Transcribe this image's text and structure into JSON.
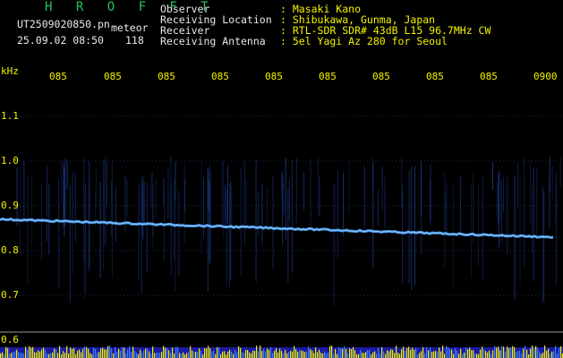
{
  "app": {
    "title": "H R O F F T"
  },
  "file": {
    "name": "UT2509020850.pn",
    "meteor_label": "meteor"
  },
  "timestamp": {
    "datetime": "25.09.02 08:50",
    "count": "118"
  },
  "info": {
    "rows": [
      {
        "label": "Observer",
        "value": ": Masaki Kano"
      },
      {
        "label": "Receiving Location",
        "value": ": Shibukawa, Gunma, Japan"
      },
      {
        "label": "Receiver",
        "value": ": RTL-SDR SDR# 43dB L15 96.7MHz CW"
      },
      {
        "label": "Receiving Antenna",
        "value": ": 5el Yagi Az 280 for Seoul"
      }
    ]
  },
  "axis": {
    "unit": "kHz",
    "y_ticks": [
      "1.1",
      "1.0",
      "0.9",
      "0.8",
      "0.7",
      "0.6"
    ],
    "x_ticks": [
      "085",
      "085",
      "085",
      "085",
      "085",
      "085",
      "085",
      "085",
      "085",
      "0900"
    ]
  },
  "colors": {
    "background": "#000000",
    "header_label": "#ffffff",
    "header_value": "#ffff00",
    "title": "#22c55e",
    "axis_text": "#ffff00",
    "trace": "#4da6ff",
    "noise": "#1e3a8a"
  }
}
